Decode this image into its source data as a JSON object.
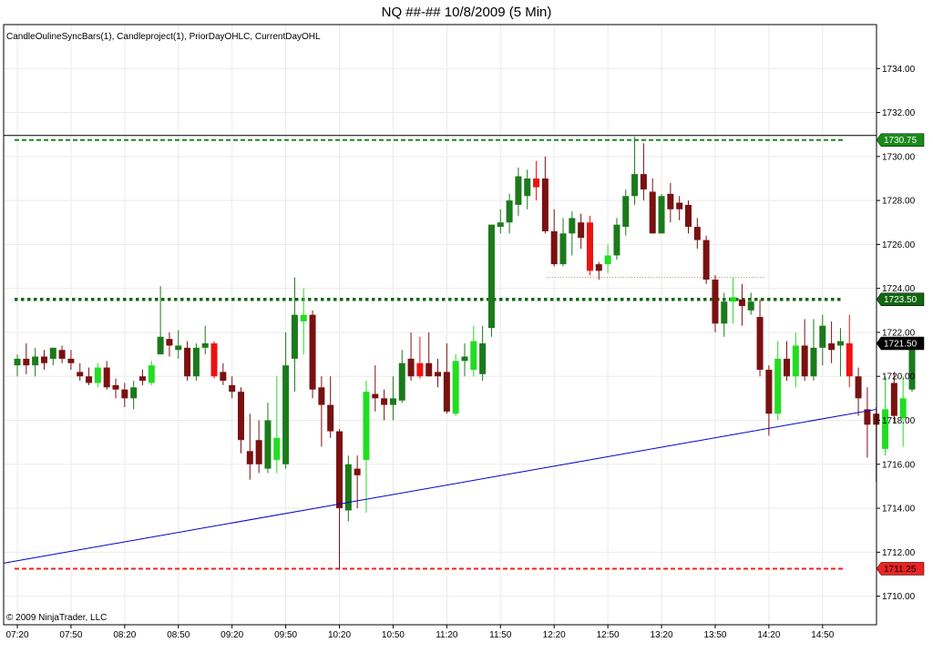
{
  "chart_data": {
    "type": "candlestick",
    "title": "NQ ##-##  10/8/2009 (5 Min)",
    "indicator_label": "CandleOulineSyncBars(1), Candleproject(1), PriorDayOHLC, CurrentDayOHL",
    "copyright": "© 2009 NinjaTrader, LLC",
    "ylim": [
      1708.7,
      1736.0
    ],
    "y_ticks": [
      "1710.00",
      "1712.00",
      "1714.00",
      "1716.00",
      "1718.00",
      "1720.00",
      "1722.00",
      "1724.00",
      "1726.00",
      "1728.00",
      "1730.00",
      "1732.00",
      "1734.00"
    ],
    "x_ticks": [
      {
        "i": 0,
        "label": "07:20"
      },
      {
        "i": 6,
        "label": "07:50"
      },
      {
        "i": 12,
        "label": "08:20"
      },
      {
        "i": 18,
        "label": "08:50"
      },
      {
        "i": 24,
        "label": "09:20"
      },
      {
        "i": 30,
        "label": "09:50"
      },
      {
        "i": 36,
        "label": "10:20"
      },
      {
        "i": 42,
        "label": "10:50"
      },
      {
        "i": 48,
        "label": "11:20"
      },
      {
        "i": 54,
        "label": "11:50"
      },
      {
        "i": 60,
        "label": "12:20"
      },
      {
        "i": 66,
        "label": "12:50"
      },
      {
        "i": 72,
        "label": "13:20"
      },
      {
        "i": 78,
        "label": "13:50"
      },
      {
        "i": 84,
        "label": "14:20"
      },
      {
        "i": 90,
        "label": "14:50"
      }
    ],
    "candles": [
      {
        "o": 1720.5,
        "h": 1721.0,
        "l": 1720.0,
        "c": 1720.8,
        "k": "dg"
      },
      {
        "o": 1720.8,
        "h": 1721.5,
        "l": 1720.1,
        "c": 1720.5,
        "k": "dr"
      },
      {
        "o": 1720.5,
        "h": 1721.3,
        "l": 1720.0,
        "c": 1720.9,
        "k": "dg"
      },
      {
        "o": 1720.9,
        "h": 1721.2,
        "l": 1720.3,
        "c": 1720.6,
        "k": "dr"
      },
      {
        "o": 1720.8,
        "h": 1721.3,
        "l": 1720.5,
        "c": 1721.3,
        "k": "dg"
      },
      {
        "o": 1721.2,
        "h": 1721.4,
        "l": 1720.6,
        "c": 1720.8,
        "k": "dr"
      },
      {
        "o": 1720.8,
        "h": 1721.2,
        "l": 1720.3,
        "c": 1720.6,
        "k": "dr"
      },
      {
        "o": 1720.2,
        "h": 1720.6,
        "l": 1719.8,
        "c": 1720.0,
        "k": "dr"
      },
      {
        "o": 1720.0,
        "h": 1720.4,
        "l": 1719.6,
        "c": 1719.7,
        "k": "dr"
      },
      {
        "o": 1719.7,
        "h": 1720.6,
        "l": 1719.5,
        "c": 1720.4,
        "k": "lg"
      },
      {
        "o": 1720.4,
        "h": 1720.7,
        "l": 1719.4,
        "c": 1719.5,
        "k": "dr"
      },
      {
        "o": 1719.6,
        "h": 1719.9,
        "l": 1719.0,
        "c": 1719.4,
        "k": "dr"
      },
      {
        "o": 1719.4,
        "h": 1719.7,
        "l": 1718.6,
        "c": 1719.0,
        "k": "dr"
      },
      {
        "o": 1719.0,
        "h": 1719.8,
        "l": 1718.5,
        "c": 1719.5,
        "k": "dg"
      },
      {
        "o": 1719.8,
        "h": 1720.3,
        "l": 1719.6,
        "c": 1720.0,
        "k": "dr"
      },
      {
        "o": 1719.7,
        "h": 1720.7,
        "l": 1719.6,
        "c": 1720.5,
        "k": "lg"
      },
      {
        "o": 1721.0,
        "h": 1724.1,
        "l": 1721.0,
        "c": 1721.8,
        "k": "dg"
      },
      {
        "o": 1721.7,
        "h": 1722.0,
        "l": 1720.9,
        "c": 1721.4,
        "k": "dr"
      },
      {
        "o": 1721.2,
        "h": 1722.1,
        "l": 1720.8,
        "c": 1721.4,
        "k": "dg"
      },
      {
        "o": 1721.3,
        "h": 1721.6,
        "l": 1719.8,
        "c": 1720.0,
        "k": "dr"
      },
      {
        "o": 1720.0,
        "h": 1721.5,
        "l": 1719.8,
        "c": 1721.3,
        "k": "dg"
      },
      {
        "o": 1721.3,
        "h": 1722.3,
        "l": 1721.0,
        "c": 1721.5,
        "k": "dg"
      },
      {
        "o": 1721.5,
        "h": 1721.6,
        "l": 1719.9,
        "c": 1720.0,
        "k": "br"
      },
      {
        "o": 1720.2,
        "h": 1720.6,
        "l": 1719.6,
        "c": 1719.8,
        "k": "dr"
      },
      {
        "o": 1719.6,
        "h": 1720.0,
        "l": 1719.0,
        "c": 1719.3,
        "k": "dr"
      },
      {
        "o": 1719.3,
        "h": 1719.5,
        "l": 1716.5,
        "c": 1717.1,
        "k": "dr"
      },
      {
        "o": 1716.6,
        "h": 1718.3,
        "l": 1715.3,
        "c": 1716.0,
        "k": "dr"
      },
      {
        "o": 1716.0,
        "h": 1718.0,
        "l": 1715.6,
        "c": 1717.1,
        "k": "dr"
      },
      {
        "o": 1715.8,
        "h": 1718.8,
        "l": 1715.6,
        "c": 1718.0,
        "k": "dg"
      },
      {
        "o": 1716.2,
        "h": 1720.0,
        "l": 1715.6,
        "c": 1717.2,
        "k": "lg"
      },
      {
        "o": 1716.0,
        "h": 1722.0,
        "l": 1715.8,
        "c": 1720.5,
        "k": "dg"
      },
      {
        "o": 1720.8,
        "h": 1724.5,
        "l": 1719.3,
        "c": 1722.8,
        "k": "dg"
      },
      {
        "o": 1722.5,
        "h": 1724.0,
        "l": 1721.0,
        "c": 1722.8,
        "k": "lg"
      },
      {
        "o": 1722.8,
        "h": 1723.0,
        "l": 1719.0,
        "c": 1719.4,
        "k": "dr"
      },
      {
        "o": 1719.5,
        "h": 1720.0,
        "l": 1716.8,
        "c": 1718.7,
        "k": "dr"
      },
      {
        "o": 1718.7,
        "h": 1720.0,
        "l": 1717.2,
        "c": 1717.5,
        "k": "dr"
      },
      {
        "o": 1717.5,
        "h": 1717.6,
        "l": 1711.2,
        "c": 1714.0,
        "k": "dr"
      },
      {
        "o": 1713.9,
        "h": 1716.4,
        "l": 1713.4,
        "c": 1716.0,
        "k": "dg"
      },
      {
        "o": 1715.5,
        "h": 1716.4,
        "l": 1714.0,
        "c": 1715.8,
        "k": "dr"
      },
      {
        "o": 1716.2,
        "h": 1719.8,
        "l": 1713.8,
        "c": 1719.3,
        "k": "lg"
      },
      {
        "o": 1719.2,
        "h": 1720.5,
        "l": 1718.4,
        "c": 1719.0,
        "k": "dr"
      },
      {
        "o": 1719.0,
        "h": 1719.4,
        "l": 1718.0,
        "c": 1718.7,
        "k": "dr"
      },
      {
        "o": 1718.7,
        "h": 1720.0,
        "l": 1718.0,
        "c": 1719.0,
        "k": "dg"
      },
      {
        "o": 1718.9,
        "h": 1721.2,
        "l": 1718.8,
        "c": 1720.6,
        "k": "dg"
      },
      {
        "o": 1720.8,
        "h": 1722.0,
        "l": 1719.8,
        "c": 1720.0,
        "k": "dr"
      },
      {
        "o": 1720.0,
        "h": 1721.8,
        "l": 1719.9,
        "c": 1720.6,
        "k": "br"
      },
      {
        "o": 1720.6,
        "h": 1722.0,
        "l": 1720.0,
        "c": 1720.0,
        "k": "dr"
      },
      {
        "o": 1720.0,
        "h": 1720.8,
        "l": 1719.5,
        "c": 1720.2,
        "k": "dr"
      },
      {
        "o": 1720.2,
        "h": 1721.5,
        "l": 1718.3,
        "c": 1718.4,
        "k": "dr"
      },
      {
        "o": 1718.3,
        "h": 1721.0,
        "l": 1718.2,
        "c": 1720.7,
        "k": "lg"
      },
      {
        "o": 1720.7,
        "h": 1721.5,
        "l": 1720.0,
        "c": 1720.9,
        "k": "dg"
      },
      {
        "o": 1720.3,
        "h": 1722.3,
        "l": 1720.0,
        "c": 1721.6,
        "k": "lg"
      },
      {
        "o": 1720.1,
        "h": 1722.3,
        "l": 1719.8,
        "c": 1721.5,
        "k": "dg"
      },
      {
        "o": 1722.2,
        "h": 1726.9,
        "l": 1721.8,
        "c": 1726.9,
        "k": "dg"
      },
      {
        "o": 1726.8,
        "h": 1727.6,
        "l": 1726.5,
        "c": 1727.0,
        "k": "dg"
      },
      {
        "o": 1727.0,
        "h": 1728.3,
        "l": 1726.5,
        "c": 1728.0,
        "k": "dg"
      },
      {
        "o": 1727.8,
        "h": 1729.5,
        "l": 1727.3,
        "c": 1729.1,
        "k": "dg"
      },
      {
        "o": 1728.2,
        "h": 1729.4,
        "l": 1727.6,
        "c": 1729.0,
        "k": "dg"
      },
      {
        "o": 1729.0,
        "h": 1729.8,
        "l": 1728.0,
        "c": 1728.6,
        "k": "br"
      },
      {
        "o": 1729.0,
        "h": 1730.0,
        "l": 1726.5,
        "c": 1726.6,
        "k": "dr"
      },
      {
        "o": 1726.6,
        "h": 1727.6,
        "l": 1725.0,
        "c": 1725.1,
        "k": "dr"
      },
      {
        "o": 1725.1,
        "h": 1727.2,
        "l": 1725.0,
        "c": 1726.5,
        "k": "dg"
      },
      {
        "o": 1726.5,
        "h": 1727.5,
        "l": 1725.5,
        "c": 1727.2,
        "k": "dg"
      },
      {
        "o": 1727.0,
        "h": 1727.4,
        "l": 1725.8,
        "c": 1726.3,
        "k": "dr"
      },
      {
        "o": 1727.0,
        "h": 1727.3,
        "l": 1724.6,
        "c": 1724.8,
        "k": "br"
      },
      {
        "o": 1724.8,
        "h": 1725.2,
        "l": 1724.4,
        "c": 1725.1,
        "k": "dr"
      },
      {
        "o": 1725.1,
        "h": 1726.0,
        "l": 1724.7,
        "c": 1725.5,
        "k": "lg"
      },
      {
        "o": 1725.5,
        "h": 1727.2,
        "l": 1725.3,
        "c": 1726.9,
        "k": "dg"
      },
      {
        "o": 1726.8,
        "h": 1728.5,
        "l": 1726.4,
        "c": 1728.2,
        "k": "dg"
      },
      {
        "o": 1728.2,
        "h": 1730.9,
        "l": 1727.8,
        "c": 1729.2,
        "k": "dg"
      },
      {
        "o": 1729.2,
        "h": 1730.6,
        "l": 1728.0,
        "c": 1728.5,
        "k": "dr"
      },
      {
        "o": 1728.4,
        "h": 1729.0,
        "l": 1726.5,
        "c": 1726.5,
        "k": "dr"
      },
      {
        "o": 1726.5,
        "h": 1728.3,
        "l": 1726.5,
        "c": 1728.2,
        "k": "dg"
      },
      {
        "o": 1728.3,
        "h": 1728.8,
        "l": 1727.0,
        "c": 1727.6,
        "k": "dr"
      },
      {
        "o": 1727.6,
        "h": 1728.2,
        "l": 1727.1,
        "c": 1727.9,
        "k": "dr"
      },
      {
        "o": 1727.8,
        "h": 1728.0,
        "l": 1726.5,
        "c": 1726.8,
        "k": "dr"
      },
      {
        "o": 1726.8,
        "h": 1727.2,
        "l": 1725.8,
        "c": 1726.2,
        "k": "dr"
      },
      {
        "o": 1726.2,
        "h": 1726.4,
        "l": 1724.2,
        "c": 1724.4,
        "k": "dr"
      },
      {
        "o": 1724.4,
        "h": 1724.6,
        "l": 1722.0,
        "c": 1722.4,
        "k": "dr"
      },
      {
        "o": 1722.4,
        "h": 1723.8,
        "l": 1721.8,
        "c": 1723.4,
        "k": "dg"
      },
      {
        "o": 1723.4,
        "h": 1724.5,
        "l": 1722.4,
        "c": 1723.6,
        "k": "lg"
      },
      {
        "o": 1723.5,
        "h": 1724.2,
        "l": 1722.3,
        "c": 1723.2,
        "k": "dr"
      },
      {
        "o": 1723.4,
        "h": 1723.8,
        "l": 1722.8,
        "c": 1723.0,
        "k": "dg"
      },
      {
        "o": 1722.7,
        "h": 1723.5,
        "l": 1720.0,
        "c": 1720.3,
        "k": "dr"
      },
      {
        "o": 1720.3,
        "h": 1720.5,
        "l": 1717.3,
        "c": 1718.3,
        "k": "dr"
      },
      {
        "o": 1718.3,
        "h": 1721.6,
        "l": 1718.0,
        "c": 1720.8,
        "k": "lg"
      },
      {
        "o": 1720.8,
        "h": 1721.6,
        "l": 1719.8,
        "c": 1720.0,
        "k": "dr"
      },
      {
        "o": 1720.0,
        "h": 1722.0,
        "l": 1719.5,
        "c": 1721.4,
        "k": "lg"
      },
      {
        "o": 1721.4,
        "h": 1722.6,
        "l": 1719.8,
        "c": 1720.0,
        "k": "dr"
      },
      {
        "o": 1720.0,
        "h": 1722.6,
        "l": 1719.8,
        "c": 1721.3,
        "k": "dg"
      },
      {
        "o": 1721.3,
        "h": 1722.8,
        "l": 1720.5,
        "c": 1722.3,
        "k": "dg"
      },
      {
        "o": 1721.5,
        "h": 1722.5,
        "l": 1720.6,
        "c": 1721.2,
        "k": "dr"
      },
      {
        "o": 1721.4,
        "h": 1722.2,
        "l": 1720.0,
        "c": 1721.6,
        "k": "dg"
      },
      {
        "o": 1721.5,
        "h": 1722.8,
        "l": 1719.5,
        "c": 1720.0,
        "k": "br"
      },
      {
        "o": 1720.0,
        "h": 1720.4,
        "l": 1718.2,
        "c": 1719.0,
        "k": "dr"
      },
      {
        "o": 1717.8,
        "h": 1719.5,
        "l": 1716.3,
        "c": 1718.5,
        "k": "dr"
      },
      {
        "o": 1718.3,
        "h": 1718.6,
        "l": 1715.2,
        "c": 1717.8,
        "k": "dr"
      },
      {
        "o": 1716.7,
        "h": 1720.0,
        "l": 1716.4,
        "c": 1718.5,
        "k": "lg"
      },
      {
        "o": 1718.2,
        "h": 1720.2,
        "l": 1717.9,
        "c": 1719.7,
        "k": "dr"
      },
      {
        "o": 1718.1,
        "h": 1720.0,
        "l": 1716.8,
        "c": 1719.0,
        "k": "lg"
      },
      {
        "o": 1719.4,
        "h": 1721.7,
        "l": 1719.3,
        "c": 1721.5,
        "k": "dg"
      }
    ],
    "levels": {
      "prior_high": "1730.75",
      "mid": "1723.50",
      "last": "1721.50",
      "prior_low": "1711.25"
    },
    "level_values": {
      "prior_high": 1730.75,
      "mid": 1723.5,
      "last": 1721.5,
      "prior_low": 1711.25
    },
    "colors": {
      "dark_green": "#1b7a1b",
      "light_green": "#22dd22",
      "dark_red": "#7a1111",
      "bright_red": "#ee1111",
      "trendline": "#0000cc",
      "prior_high": "#1a8a1a",
      "mid": "#116611",
      "prior_low": "#ee2222",
      "tag_last": "#000000"
    }
  }
}
